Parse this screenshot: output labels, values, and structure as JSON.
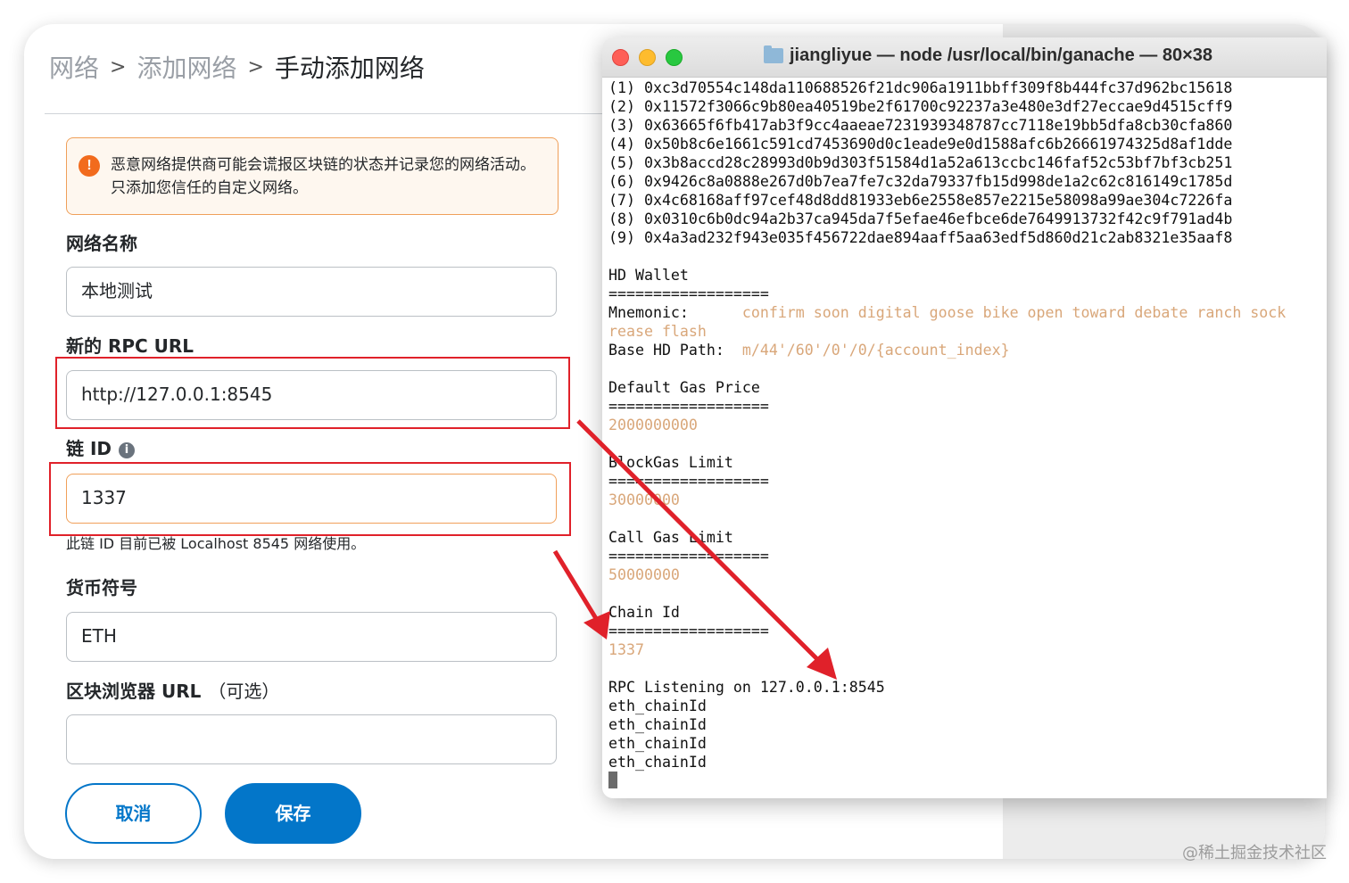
{
  "breadcrumb": {
    "item1": "网络",
    "item2": "添加网络",
    "current": "手动添加网络",
    "separator": ">"
  },
  "warning": {
    "icon": "!",
    "text": "恶意网络提供商可能会谎报区块链的状态并记录您的网络活动。只添加您信任的自定义网络。"
  },
  "form": {
    "network_name_label": "网络名称",
    "network_name_value": "本地测试",
    "rpc_label": "新的 RPC URL",
    "rpc_value": "http://127.0.0.1:8545",
    "chain_id_label": "链 ID",
    "chain_id_info_icon": "i",
    "chain_id_value": "1337",
    "chain_id_hint": "此链 ID 目前已被 Localhost 8545 网络使用。",
    "currency_label": "货币符号",
    "currency_value": "ETH",
    "explorer_label": "区块浏览器 URL",
    "explorer_optional": "（可选）",
    "explorer_value": ""
  },
  "buttons": {
    "cancel": "取消",
    "save": "保存"
  },
  "terminal": {
    "title": "jiangliyue — node /usr/local/bin/ganache — 80×38",
    "lines": [
      {
        "text": "(1) 0xc3d70554c148da110688526f21dc906a1911bbff309f8b444fc37d962bc15618"
      },
      {
        "text": "(2) 0x11572f3066c9b80ea40519be2f61700c92237a3e480e3df27eccae9d4515cff9"
      },
      {
        "text": "(3) 0x63665f6fb417ab3f9cc4aaeae7231939348787cc7118e19bb5dfa8cb30cfa860"
      },
      {
        "text": "(4) 0x50b8c6e1661c591cd7453690d0c1eade9e0d1588afc6b26661974325d8af1dde"
      },
      {
        "text": "(5) 0x3b8accd28c28993d0b9d303f51584d1a52a613ccbc146faf52c53bf7bf3cb251"
      },
      {
        "text": "(6) 0x9426c8a0888e267d0b7ea7fe7c32da79337fb15d998de1a2c62c816149c1785d"
      },
      {
        "text": "(7) 0x4c68168aff97cef48d8dd81933eb6e2558e857e2215e58098a99ae304c7226fa"
      },
      {
        "text": "(8) 0x0310c6b0dc94a2b37ca945da7f5efae46efbce6de7649913732f42c9f791ad4b"
      },
      {
        "text": "(9) 0x4a3ad232f943e035f456722dae894aaff5aa63edf5d860d21c2ab8321e35aaf8"
      },
      {
        "text": ""
      },
      {
        "text": "HD Wallet"
      },
      {
        "text": "=================="
      },
      {
        "text": "Mnemonic:      ",
        "hl": "confirm soon digital goose bike open toward debate ranch sock"
      },
      {
        "text": "",
        "hl": "rease flash"
      },
      {
        "text": "Base HD Path:  ",
        "hl": "m/44'/60'/0'/0/{account_index}"
      },
      {
        "text": ""
      },
      {
        "text": "Default Gas Price"
      },
      {
        "text": "=================="
      },
      {
        "text": "",
        "hl": "2000000000"
      },
      {
        "text": ""
      },
      {
        "text": "BlockGas Limit"
      },
      {
        "text": "=================="
      },
      {
        "text": "",
        "hl": "30000000"
      },
      {
        "text": ""
      },
      {
        "text": "Call Gas Limit"
      },
      {
        "text": "=================="
      },
      {
        "text": "",
        "hl": "50000000"
      },
      {
        "text": ""
      },
      {
        "text": "Chain Id"
      },
      {
        "text": "=================="
      },
      {
        "text": "",
        "hl": "1337"
      },
      {
        "text": ""
      },
      {
        "text": "RPC Listening on 127.0.0.1:8545"
      },
      {
        "text": "eth_chainId"
      },
      {
        "text": "eth_chainId"
      },
      {
        "text": "eth_chainId"
      },
      {
        "text": "eth_chainId"
      }
    ]
  },
  "watermark": "@稀土掘金技术社区",
  "colors": {
    "accent": "#0376c9",
    "warning_border": "#f0a05a",
    "warning_icon": "#f26b1d",
    "annotation_red": "#e0212a",
    "terminal_highlight": "#d9a77a"
  }
}
